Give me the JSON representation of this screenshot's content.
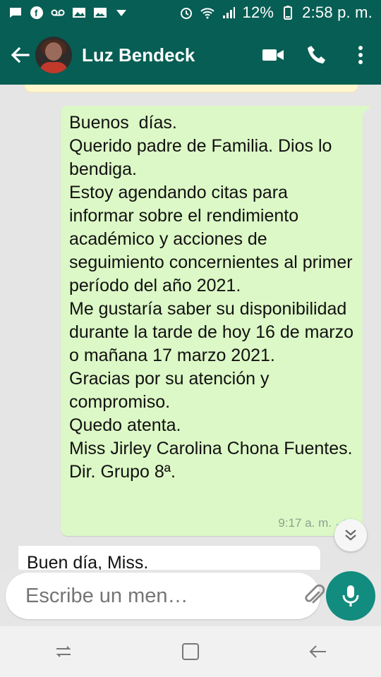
{
  "status_bar": {
    "battery": "12%",
    "time": "2:58 p. m."
  },
  "chat": {
    "contact_name": "Luz Bendeck"
  },
  "messages": {
    "outgoing": {
      "text": "Buenos  días.\nQuerido padre de Familia. Dios lo bendiga.\nEstoy agendando citas para informar sobre el rendimiento académico y acciones de seguimiento concernientes al primer período del año 2021.\nMe gustaría saber su disponibilidad durante la tarde de hoy 16 de marzo o mañana 17 marzo 2021.\nGracias por su atención y compromiso.\nQuedo atenta.\nMiss Jirley Carolina Chona Fuentes.\nDir. Grupo 8ª.",
      "time": "9:17 a. m."
    },
    "incoming": {
      "text": "Buen día, Miss."
    }
  },
  "composer": {
    "placeholder": "Escribe un men…"
  },
  "icons": {
    "status_left": [
      "message-icon",
      "facebook-icon",
      "voicemail-icon",
      "gallery-icon",
      "image-icon",
      "dropdown-icon"
    ],
    "status_right": [
      "alarm-icon",
      "wifi-icon",
      "signal-icon",
      "battery-icon"
    ],
    "appbar": [
      "back-arrow-icon",
      "video-call-icon",
      "phone-icon",
      "more-vert-icon"
    ],
    "composer": [
      "emoji-icon",
      "attach-icon",
      "camera-icon",
      "mic-icon"
    ],
    "navbar": [
      "recents-icon",
      "home-icon",
      "back-icon"
    ]
  },
  "colors": {
    "header": "#075e54",
    "outgoing_bubble": "#dcf8c6",
    "mic_button": "#128c7e"
  }
}
